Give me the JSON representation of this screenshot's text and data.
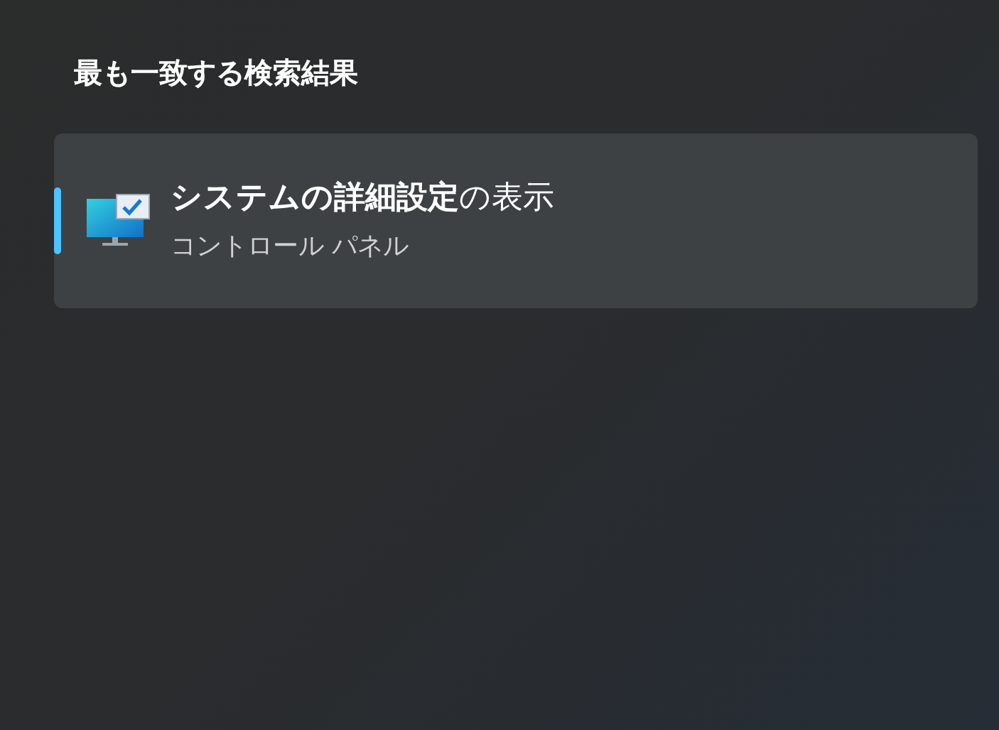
{
  "section_title": "最も一致する検索結果",
  "results": [
    {
      "title": "**システムの詳細設定**の表示",
      "subtitle": "コントロール パネル",
      "selected": true
    }
  ]
}
